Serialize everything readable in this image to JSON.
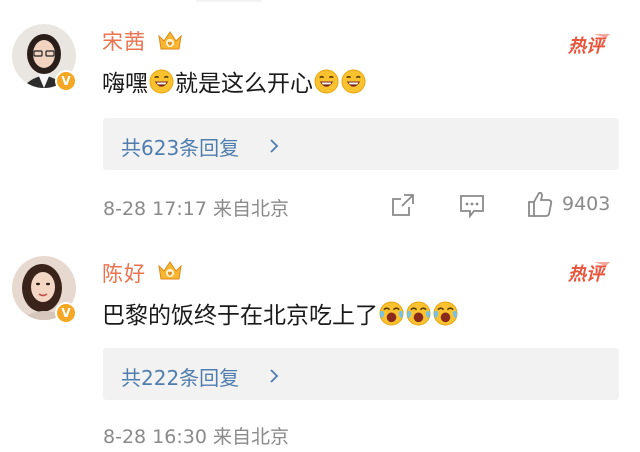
{
  "comments": [
    {
      "name": "宋茜",
      "text": "嗨嘿",
      "text_after": "就是这么开心",
      "replies_label": "共623条回复",
      "meta": "8-28 17:17  来自北京",
      "likes": "9403",
      "hot_label": "热评"
    },
    {
      "name": "陈好",
      "text": "巴黎的饭终于在北京吃上了",
      "replies_label": "共222条回复",
      "meta": "8-28 16:30  来自北京",
      "hot_label": "热评"
    }
  ],
  "colors": {
    "name": "#eb7350",
    "link": "#507daf",
    "meta": "#8a8a8a",
    "hot": "#e8563d",
    "badge": "#f5a623"
  },
  "icons": {
    "share": "share-icon",
    "comment": "comment-icon",
    "like": "like-icon",
    "crown": "crown-icon",
    "verified": "verified-badge-icon"
  }
}
